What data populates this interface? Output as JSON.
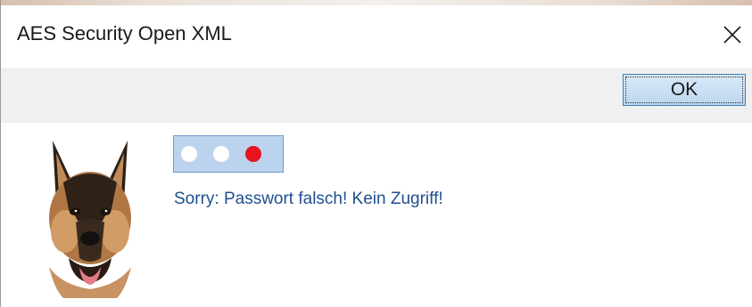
{
  "window": {
    "title": "AES Security Open XML"
  },
  "toolbar": {
    "ok_label": "OK"
  },
  "status": {
    "indicator_lights": [
      {
        "state": "off",
        "color": "#ffffff"
      },
      {
        "state": "off",
        "color": "#ffffff"
      },
      {
        "state": "on",
        "color": "#e8141e"
      }
    ],
    "message": "Sorry: Passwort falsch! Kein Zugriff!"
  },
  "icons": {
    "close": "close-icon",
    "image": "german-shepherd-dog-image"
  },
  "colors": {
    "toolbar_bg": "#f0f0f0",
    "indicator_bg": "#bcd3ee",
    "message_text": "#1f4f8f",
    "error_light": "#e8141e"
  }
}
